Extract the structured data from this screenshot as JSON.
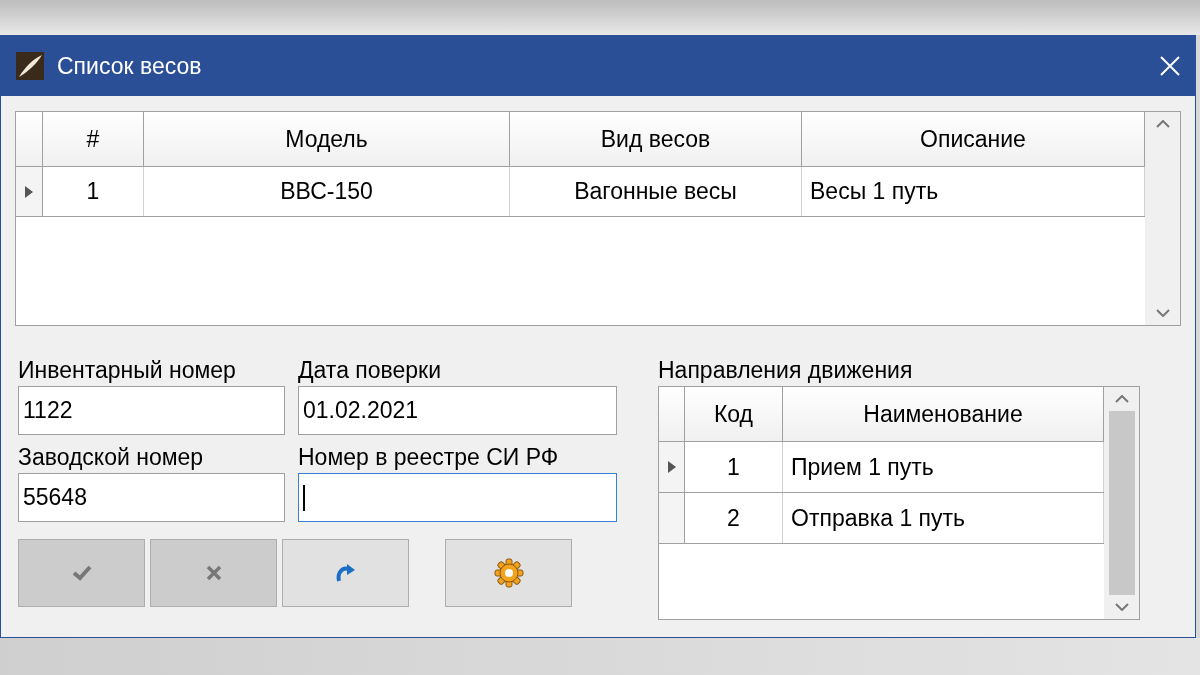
{
  "window": {
    "title": "Список весов"
  },
  "scales_table": {
    "columns": [
      "#",
      "Модель",
      "Вид весов",
      "Описание"
    ],
    "rows": [
      {
        "selected": true,
        "cells": [
          "1",
          "ВВС-150",
          "Вагонные весы",
          "Весы 1 путь"
        ]
      }
    ]
  },
  "fields": [
    {
      "label": "Инвентарный номер",
      "value": "1122",
      "focused": false
    },
    {
      "label": "Дата поверки",
      "value": "01.02.2021",
      "focused": false
    },
    {
      "label": "Заводской номер",
      "value": "55648",
      "focused": false
    },
    {
      "label": "Номер в реестре СИ РФ",
      "focused": true
    }
  ],
  "buttons": [
    {
      "kind": "check",
      "disabled": true
    },
    {
      "kind": "cross",
      "disabled": true
    },
    {
      "kind": "redo",
      "disabled": false
    },
    {
      "kind": "gear",
      "disabled": false
    }
  ],
  "directions": {
    "label": "Направления движения",
    "columns": [
      "Код",
      "Наименование"
    ],
    "rows": [
      {
        "selected": true,
        "cells": [
          "1",
          "Прием 1 путь"
        ]
      },
      {
        "selected": false,
        "cells": [
          "2",
          "Отправка 1 путь"
        ]
      }
    ]
  }
}
